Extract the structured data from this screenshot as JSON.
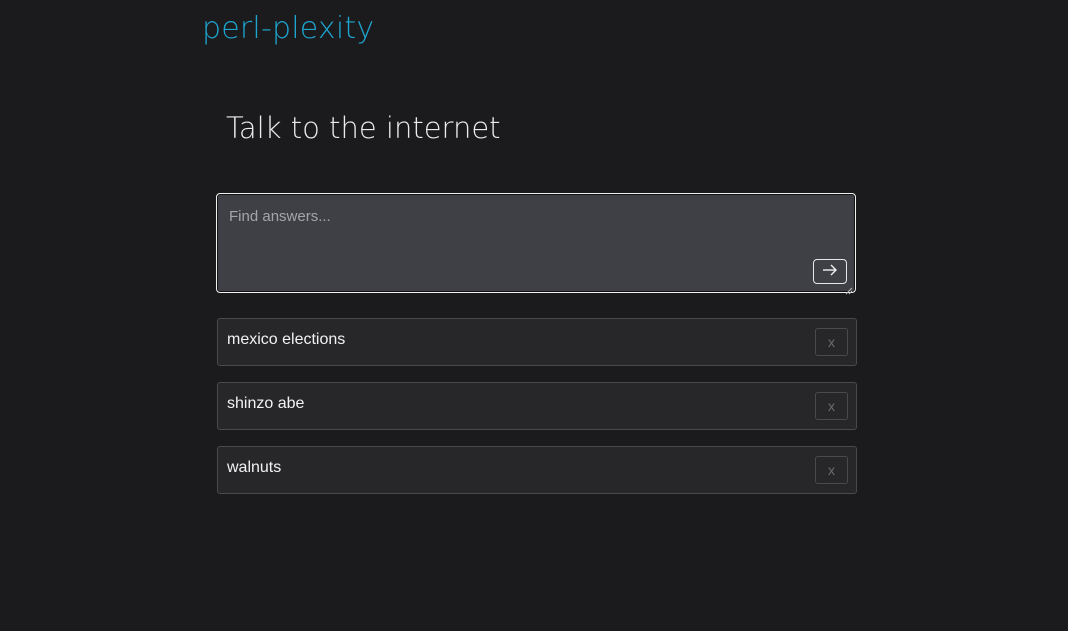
{
  "app": {
    "brand": "perl-plexity",
    "headline": "Talk to the internet",
    "brand_color": "#1ea4cf",
    "background_color": "#1b1b1d"
  },
  "search": {
    "placeholder": "Find answers...",
    "value": "",
    "submit_icon": "arrow-right-icon"
  },
  "history": {
    "items": [
      {
        "label": "mexico elections",
        "remove_label": "x"
      },
      {
        "label": "shinzo abe",
        "remove_label": "x"
      },
      {
        "label": "walnuts",
        "remove_label": "x"
      }
    ]
  }
}
